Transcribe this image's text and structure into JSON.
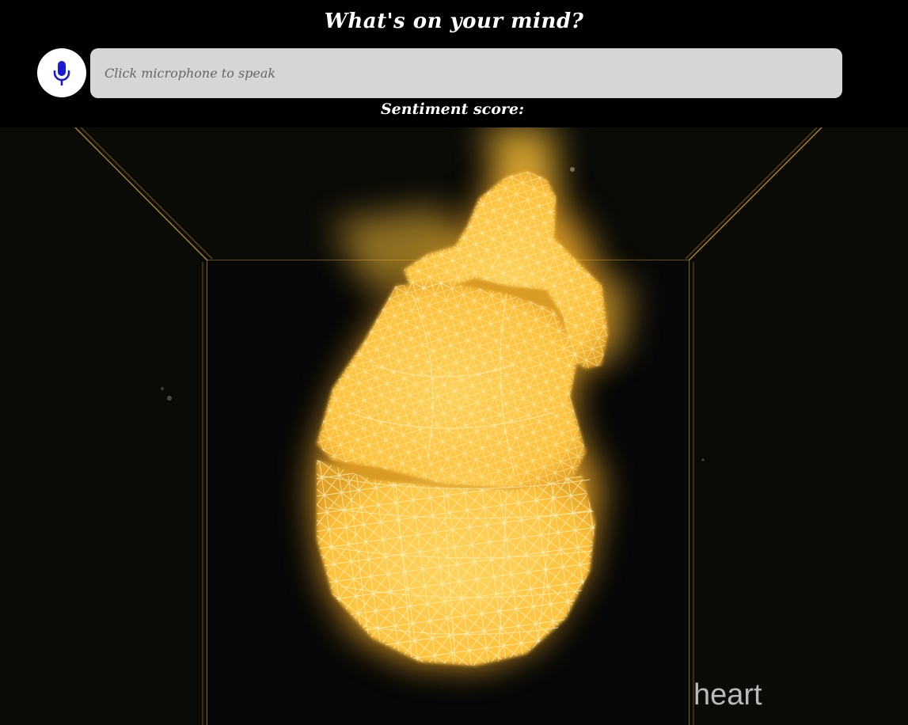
{
  "header": {
    "title": "What's on your mind?",
    "microphone_icon": "microphone-icon",
    "speech_input": {
      "placeholder": "Click microphone to speak",
      "value": ""
    },
    "sentiment_label": "Sentiment score:",
    "sentiment_value": ""
  },
  "scene": {
    "object_label": "heart",
    "render_style": "glowing wireframe",
    "colors": {
      "glow": "#ffc43a",
      "wire": "#fff0b0",
      "room_edge": "#b38622",
      "background": "#0a0a07"
    }
  }
}
